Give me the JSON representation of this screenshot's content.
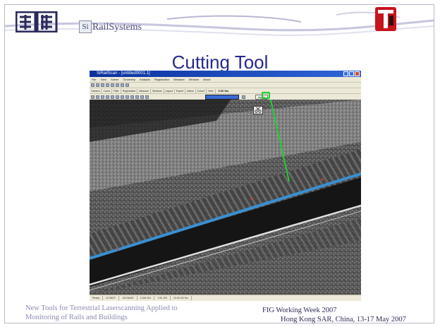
{
  "header": {
    "brand_box": "Si",
    "brand_text": "RailSystems"
  },
  "slide_title": "Cutting Tool",
  "screenshot": {
    "window_title": "SiRailScan - [untitled0001.1]",
    "menu": [
      "File",
      "View",
      "Scene",
      "Geometry",
      "Analysis",
      "Registration",
      "Measure",
      "Window",
      "About"
    ],
    "tabs": [
      "Camera",
      "Coord",
      "Filter",
      "Registration",
      "Measure",
      "Sections",
      "Layout",
      "Export",
      "Active",
      "Colour",
      "View"
    ],
    "lane_value": "5.00 lbs",
    "apply_label": "Apply",
    "status_cells": [
      "Ready",
      "22.9823°",
      "100.56467",
      "2.340 001",
      "1.00 100",
      "22.50 012 lbs"
    ],
    "colors": {
      "accent_line": "#3a8fd0",
      "highlight": "#20d030",
      "rail": "#e0e0e0"
    }
  },
  "footer": {
    "left_line1": "New Tools for Terrestrial Laserscanning Applied to",
    "left_line2": "Monitoring of Rails and Buildings",
    "right_line1": "FIG Working Week 2007",
    "right_line2": "Hong Kong SAR, China, 13-17 May 2007"
  }
}
